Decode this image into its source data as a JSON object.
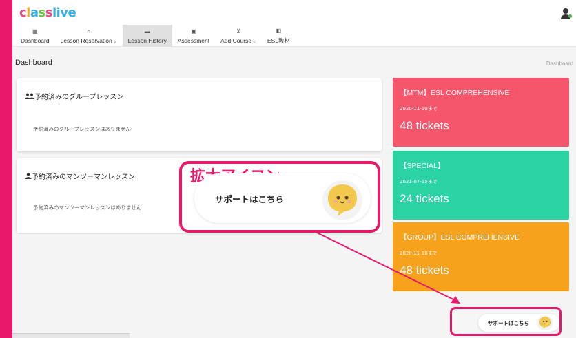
{
  "logo": {
    "text_parts": [
      "c",
      "l",
      "a",
      "s",
      "s",
      "live"
    ]
  },
  "nav": {
    "items": [
      {
        "label": "Dashboard",
        "icon": "dashboard-icon",
        "caret": ""
      },
      {
        "label": "Lesson Reservation",
        "icon": "search-icon",
        "caret": "⌄"
      },
      {
        "label": "Lesson History",
        "icon": "folder-icon",
        "caret": ""
      },
      {
        "label": "Assessment",
        "icon": "chart-icon",
        "caret": ""
      },
      {
        "label": "Add Course",
        "icon": "cart-icon",
        "caret": "⌄"
      },
      {
        "label": "ESL教材",
        "icon": "book-icon",
        "caret": ""
      }
    ],
    "active": "Lesson History"
  },
  "page": {
    "title": "Dashboard",
    "breadcrumb": "Dashboard"
  },
  "group_card": {
    "title": "予約済みのグループレッスン",
    "empty": "予約済みのグループレッスンはありません"
  },
  "m2m_card": {
    "title": "予約済みのマンツーマンレッスン",
    "empty": "予約済みのマンツーマンレッスンはありません"
  },
  "tickets": [
    {
      "name": "【MTM】ESL COMPREHENSIVE",
      "date": "2020-11-10まで",
      "count": "48 tickets",
      "color": "#f5566c"
    },
    {
      "name": "【SPECIAL】",
      "date": "2021-07-15まで",
      "count": "24 tickets",
      "color": "#2bd3a2"
    },
    {
      "name": "【GROUP】ESL COMPREHENSIVE",
      "date": "2020-11-10まで",
      "count": "48 tickets",
      "color": "#f7a21c"
    }
  ],
  "callout": {
    "label": "拡大アイコン",
    "support_text": "サポートはこちら"
  },
  "support": {
    "text": "サポートはこちら"
  },
  "colors": {
    "accent": "#e8196a"
  }
}
